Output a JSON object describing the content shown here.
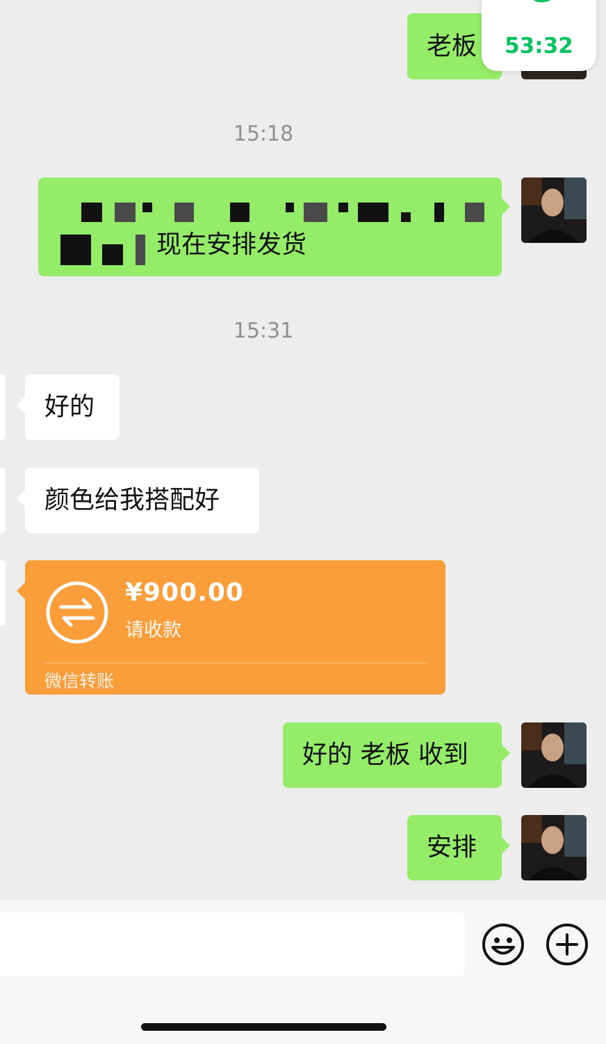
{
  "call": {
    "duration": "53:32"
  },
  "messages": {
    "m1": {
      "text": "老板"
    },
    "t1": "15:18",
    "m2": {
      "text_visible": "现在安排发货"
    },
    "t2": "15:31",
    "m3": {
      "text": "好的"
    },
    "m4": {
      "text": "颜色给我搭配好"
    },
    "transfer": {
      "amount": "¥900.00",
      "status": "请收款",
      "footer": "微信转账"
    },
    "m5": {
      "text": "好的 老板 收到"
    },
    "m6": {
      "text": "安排"
    }
  },
  "colors": {
    "sent_bubble": "#95ec69",
    "received_bubble": "#ffffff",
    "transfer": "#fa9d3b",
    "call_accent": "#07c160",
    "background": "#ededed"
  },
  "icons": {
    "transfer": "transfer-arrows-icon",
    "emoji": "emoji-icon",
    "plus": "plus-icon",
    "call": "phone-icon"
  }
}
